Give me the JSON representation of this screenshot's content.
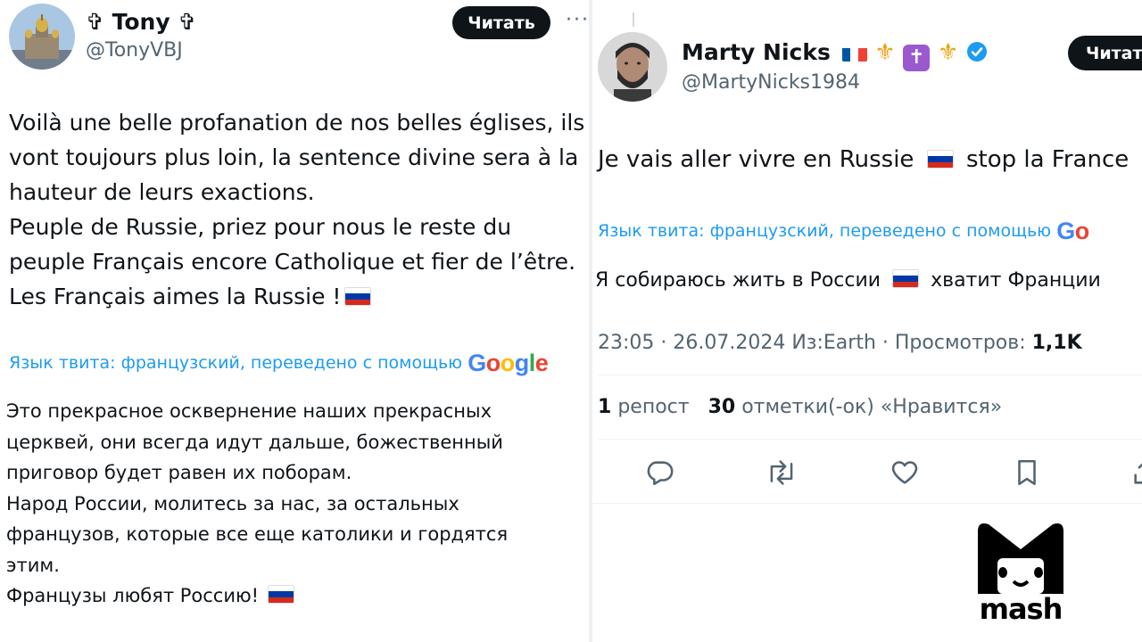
{
  "left_tweet": {
    "author_name": "✞ Tony ✞",
    "author_handle": "@TonyVBJ",
    "follow_label": "Читать",
    "more_label": "···",
    "original_lines": [
      "Voilà une belle profanation de nos belles églises, ils",
      "vont toujours plus loin, la sentence divine sera à la",
      "hauteur de leurs exactions.",
      "Peuple de Russie, priez pour nous le reste du",
      "peuple Français encore Catholique et fier de l’être.",
      "Les Français aimes la Russie !"
    ],
    "translate_note": "Язык твита: французский, переведено с помощью",
    "translated_lines": [
      "Это прекрасное осквернение наших прекрасных",
      "церквей, они всегда идут дальше, божественный",
      "приговор будет равен их поборам.",
      "Народ России, молитесь за нас, за остальных",
      "французов, которые все еще католики и гордятся",
      "этим.",
      "Французы любят Россию!"
    ]
  },
  "right_tweet": {
    "author_name": "Marty Nicks",
    "author_handle": "@MartyNicks1984",
    "name_emoji": [
      "flag-france",
      "fleur-de-lis",
      "latin-cross",
      "fleur-de-lis"
    ],
    "verified_icon": "verified-badge-icon",
    "follow_label": "Читать",
    "original_text_a": "Je vais aller vivre en Russie",
    "original_text_b": "stop la France",
    "translate_note": "Язык твита: французский, переведено с помощью",
    "translated_text_a": "Я собираюсь жить в России",
    "translated_text_b": "хватит Франции",
    "timestamp": "23:05 · 26.07.2024 Из:Earth · Просмотров:",
    "views": "1,1K",
    "reposts_count": "1",
    "reposts_label": "репост",
    "likes_count": "30",
    "likes_label": "отметки(-ок) «Нравится»",
    "actions": [
      "reply-icon",
      "retweet-icon",
      "like-icon",
      "bookmark-icon",
      "share-icon"
    ]
  },
  "google_logo": {
    "letters": [
      "G",
      "o",
      "o",
      "g",
      "l",
      "e"
    ],
    "colors": [
      "#4285F4",
      "#EA4335",
      "#FBBC05",
      "#4285F4",
      "#34A853",
      "#EA4335"
    ]
  },
  "watermark": {
    "text": "mash"
  },
  "colors": {
    "link_blue": "#1d9bf0",
    "muted": "#536471",
    "flag_ru": [
      "#ffffff",
      "#0039a6",
      "#d52b1e"
    ],
    "flag_fr": [
      "#0055a4",
      "#ffffff",
      "#ef4135"
    ],
    "verified": "#1d9bf0"
  }
}
